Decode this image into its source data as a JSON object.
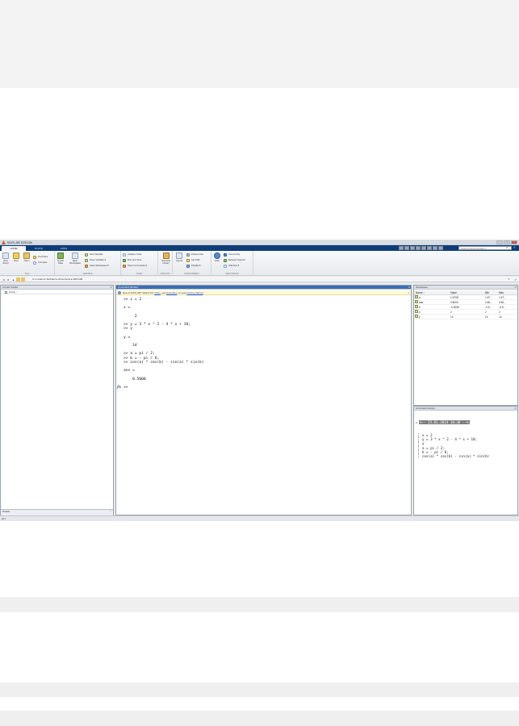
{
  "window": {
    "title": "MATLAB R2013b"
  },
  "tabs": [
    {
      "label": "HOME"
    },
    {
      "label": "PLOTS"
    },
    {
      "label": "APPS"
    }
  ],
  "search": {
    "placeholder": "Search Documentation"
  },
  "ribbon": {
    "file": {
      "group_label": "FILE",
      "new_script": "New Script",
      "new": "New",
      "open": "Open",
      "find_files": "Find Files",
      "compare": "Compare"
    },
    "variable": {
      "group_label": "VARIABLE",
      "import_data": "Import Data",
      "save_workspace": "Save Workspace",
      "new_variable": "New Variable",
      "open_variable": "Open Variable",
      "clear_workspace": "Clear Workspace"
    },
    "code": {
      "group_label": "CODE",
      "analyze_code": "Analyze Code",
      "run_and_time": "Run and Time",
      "clear_commands": "Clear Commands"
    },
    "simulink": {
      "group_label": "SIMULINK",
      "simulink_library": "Simulink Library"
    },
    "environment": {
      "group_label": "ENVIRONMENT",
      "layout": "Layout",
      "preferences": "Preferences",
      "set_path": "Set Path",
      "parallel": "Parallel"
    },
    "resources": {
      "group_label": "RESOURCES",
      "help": "Help",
      "community": "Community",
      "request_support": "Request Support",
      "add_ons": "Add-Ons"
    }
  },
  "path": {
    "text": "C: ▸ Users ▸ TestUser ▸ Documents ▸ MATLAB"
  },
  "current_folder": {
    "title": "Current Folder",
    "column_name": "Name ↑",
    "details_label": "Details"
  },
  "command_window": {
    "title": "Command Window",
    "notice_prefix": "New to MATLAB? Watch this ",
    "notice_video": "Video",
    "notice_mid": ", see ",
    "notice_examples": "Examples",
    "notice_or": ", or read ",
    "notice_getting_started": "Getting Started",
    "notice_end": ".",
    "lines": [
      ">> x = 2",
      "",
      "x =",
      "",
      "     2",
      "",
      ">> y = 3 * x ^ 2 - 4 * x + 10;",
      ">> y",
      "",
      "y =",
      "",
      "    14",
      "",
      ">> a = pi / 2;",
      ">> b = - pi / 6;",
      ">> cos(a) * cos(b) - sin(a) * sin(b)",
      "",
      "ans =",
      "",
      "    0.5000",
      "",
      ">> "
    ],
    "fx_label": "fx"
  },
  "workspace": {
    "title": "Workspace",
    "columns": {
      "name": "Name ↑",
      "value": "Value",
      "min": "Min",
      "max": "Max"
    },
    "rows": [
      {
        "name": "a",
        "value": "1.5708",
        "min": "1.57...",
        "max": "1.57..."
      },
      {
        "name": "ans",
        "value": "0.5000",
        "min": "0.50...",
        "max": "0.50..."
      },
      {
        "name": "b",
        "value": "-0.5236",
        "min": "-0.5...",
        "max": "-0.5..."
      },
      {
        "name": "x",
        "value": "2",
        "min": "2",
        "max": "2"
      },
      {
        "name": "y",
        "value": "14",
        "min": "14",
        "max": "14"
      }
    ]
  },
  "command_history": {
    "title": "Command History",
    "session": "%-- 25.01.2014 10:38 --%",
    "lines": [
      "x = 2",
      "y = 3 * x ^ 2 - 4 * x + 10;",
      "y",
      "a = pi / 2;",
      "b = - pi / 6;",
      "cos(a) * cos(b) - sin(a) * sin(b)"
    ]
  },
  "status": {
    "text": ""
  },
  "colors": {
    "ribbon_tab_bar": "#0f3d7a",
    "active_panel_header": "#3a6fb5",
    "notice_background": "#fffbd8"
  }
}
